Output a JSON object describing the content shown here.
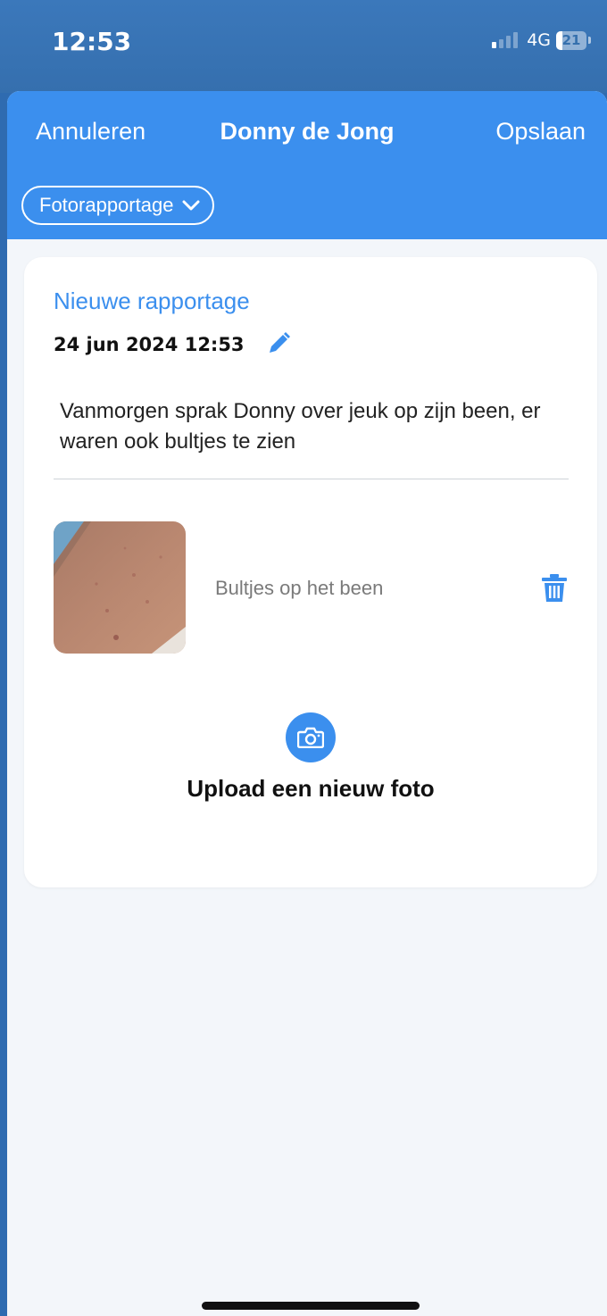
{
  "status_bar": {
    "time": "12:53",
    "network": "4G",
    "battery_percent": "21",
    "battery_level": 0.21,
    "icons": {
      "signal": "signal-icon",
      "battery": "battery-icon"
    }
  },
  "nav": {
    "cancel_label": "Annuleren",
    "title": "Donny de Jong",
    "save_label": "Opslaan"
  },
  "report_type": {
    "selected": "Fotorapportage",
    "icon": "chevron-down-icon"
  },
  "report": {
    "title": "Nieuwe rapportage",
    "datetime": "24 jun 2024 12:53",
    "edit_icon": "pencil-icon",
    "note": "Vanmorgen sprak Donny over jeuk op zijn been, er waren ook bultjes te zien"
  },
  "photos": [
    {
      "caption": "Bultjes op het been",
      "delete_icon": "trash-icon"
    }
  ],
  "upload": {
    "label": "Upload een nieuw foto",
    "icon": "camera-icon"
  },
  "colors": {
    "accent": "#3b8fee",
    "status_bar": "#356fae",
    "background": "#f3f6fa",
    "card": "#ffffff"
  }
}
